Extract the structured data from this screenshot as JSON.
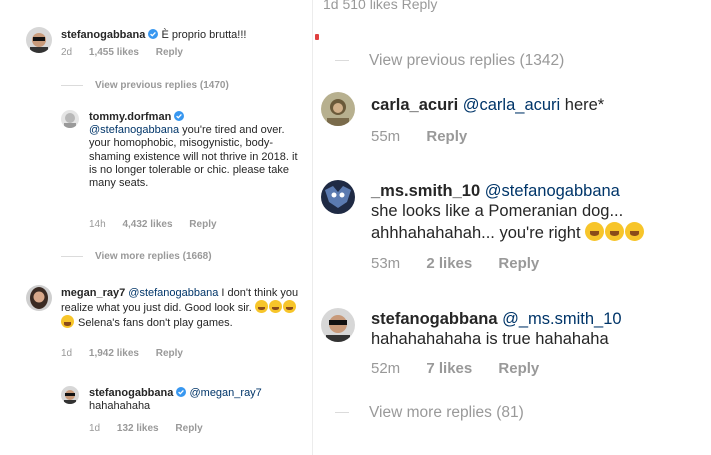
{
  "left": {
    "comments": [
      {
        "username": "stefanogabbana",
        "verified": true,
        "text": "È proprio brutta!!!",
        "time": "2d",
        "likes": "1,455 likes",
        "reply": "Reply"
      }
    ],
    "view_previous": "View previous replies (1470)",
    "reply1": {
      "username": "tommy.dorfman",
      "verified": true,
      "mention": "@stefanogabbana",
      "text": " you're tired and over. your homophobic, misogynistic, body-shaming existence will not thrive in 2018. it is no longer tolerable or chic. please take many seats.",
      "time": "14h",
      "likes": "4,432 likes",
      "reply": "Reply"
    },
    "view_more": "View more replies (1668)",
    "comment2": {
      "username": "megan_ray7",
      "mention": "@stefanogabbana",
      "text_a": " I don't think you realize what you just did. Good look sir. ",
      "text_b": " Selena's fans don't play games.",
      "time": "1d",
      "likes": "1,942 likes",
      "reply": "Reply"
    },
    "reply2": {
      "username": "stefanogabbana",
      "verified": true,
      "mention": "@megan_ray7",
      "text": "hahahahaha",
      "time": "1d",
      "likes": "132 likes",
      "reply": "Reply"
    }
  },
  "right": {
    "clipped_top": "1d   510 likes   Reply",
    "view_previous": "View previous replies (1342)",
    "reply1": {
      "username": "carla_acuri",
      "mention": "@carla_acuri",
      "text": " here*",
      "time": "55m",
      "reply": "Reply"
    },
    "reply2": {
      "username": "_ms.smith_10",
      "mention": "@stefanogabbana",
      "text_a": "she looks like a Pomeranian dog...",
      "text_b": "ahhhahahahah... you're right ",
      "time": "53m",
      "likes": "2 likes",
      "reply": "Reply"
    },
    "reply3": {
      "username": "stefanogabbana",
      "mention": "@_ms.smith_10",
      "text": "hahahahahaha is true hahahaha",
      "time": "52m",
      "likes": "7 likes",
      "reply": "Reply"
    },
    "view_more": "View more replies (81)"
  }
}
